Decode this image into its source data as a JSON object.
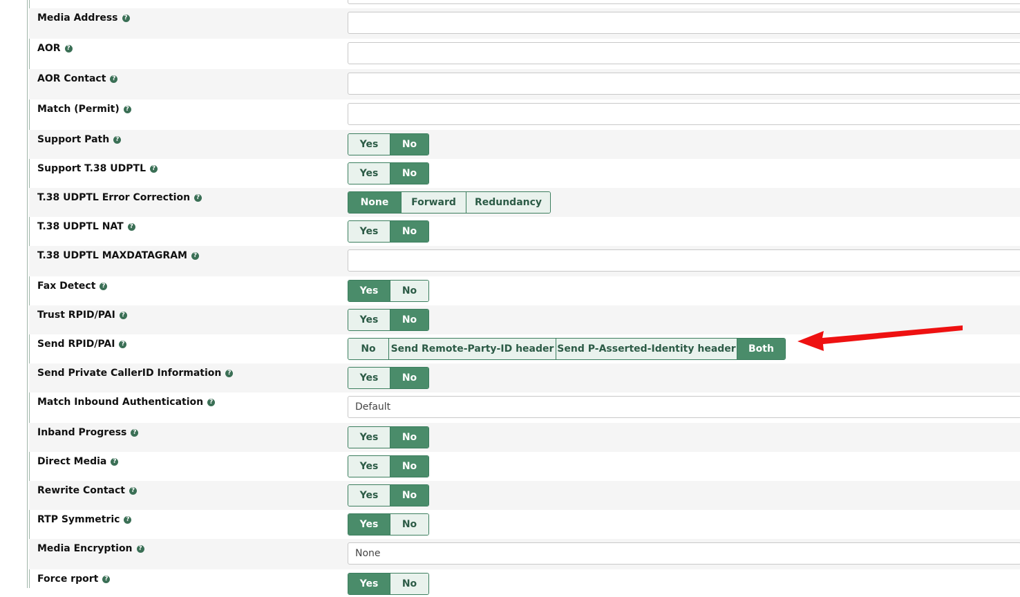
{
  "rows": [
    {
      "label": "Media Address",
      "type": "input",
      "value": ""
    },
    {
      "label": "AOR",
      "type": "input",
      "value": ""
    },
    {
      "label": "AOR Contact",
      "type": "input",
      "value": ""
    },
    {
      "label": "Match (Permit)",
      "type": "input",
      "value": ""
    },
    {
      "label": "Support Path",
      "type": "toggle",
      "options": [
        "Yes",
        "No"
      ],
      "selected": "No"
    },
    {
      "label": "Support T.38 UDPTL",
      "type": "toggle",
      "options": [
        "Yes",
        "No"
      ],
      "selected": "No"
    },
    {
      "label": "T.38 UDPTL Error Correction",
      "type": "toggle",
      "options": [
        "None",
        "Forward",
        "Redundancy"
      ],
      "selected": "None"
    },
    {
      "label": "T.38 UDPTL NAT",
      "type": "toggle",
      "options": [
        "Yes",
        "No"
      ],
      "selected": "No"
    },
    {
      "label": "T.38 UDPTL MAXDATAGRAM",
      "type": "input",
      "value": ""
    },
    {
      "label": "Fax Detect",
      "type": "toggle",
      "options": [
        "Yes",
        "No"
      ],
      "selected": "Yes"
    },
    {
      "label": "Trust RPID/PAI",
      "type": "toggle",
      "options": [
        "Yes",
        "No"
      ],
      "selected": "No"
    },
    {
      "label": "Send RPID/PAI",
      "type": "toggle",
      "options": [
        "No",
        "Send Remote-Party-ID header",
        "Send P-Asserted-Identity header",
        "Both"
      ],
      "selected": "Both"
    },
    {
      "label": "Send Private CallerID Information",
      "type": "toggle",
      "options": [
        "Yes",
        "No"
      ],
      "selected": "No"
    },
    {
      "label": "Match Inbound Authentication",
      "type": "select",
      "value": "Default"
    },
    {
      "label": "Inband Progress",
      "type": "toggle",
      "options": [
        "Yes",
        "No"
      ],
      "selected": "No"
    },
    {
      "label": "Direct Media",
      "type": "toggle",
      "options": [
        "Yes",
        "No"
      ],
      "selected": "No"
    },
    {
      "label": "Rewrite Contact",
      "type": "toggle",
      "options": [
        "Yes",
        "No"
      ],
      "selected": "No"
    },
    {
      "label": "RTP Symmetric",
      "type": "toggle",
      "options": [
        "Yes",
        "No"
      ],
      "selected": "Yes"
    },
    {
      "label": "Media Encryption",
      "type": "select",
      "value": "None"
    },
    {
      "label": "Force rport",
      "type": "toggle",
      "options": [
        "Yes",
        "No"
      ],
      "selected": "Yes"
    }
  ],
  "help_icon": "question-circle-icon",
  "accent_color": "#4a8c6a",
  "annotation_arrow_color": "#ee1111"
}
